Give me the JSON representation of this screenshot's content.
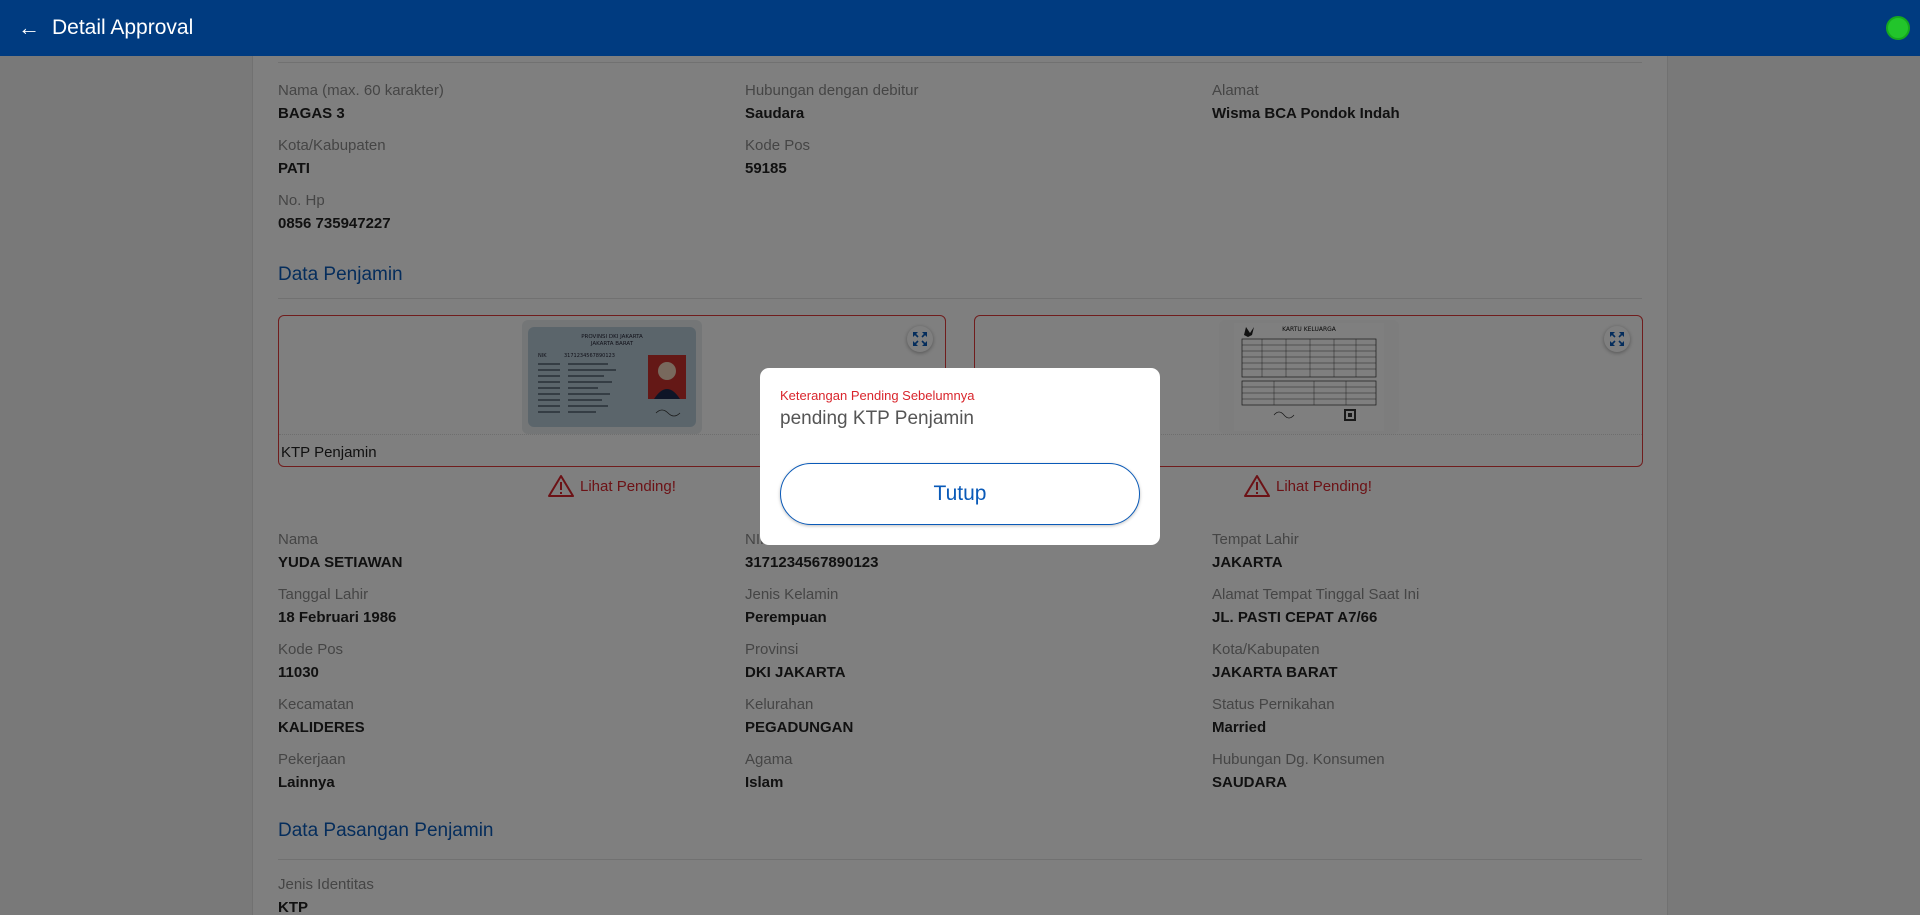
{
  "header": {
    "title": "Detail Approval",
    "back_icon": "arrow-left-icon",
    "status_color": "#22c52b"
  },
  "contact": {
    "nama": {
      "label": "Nama (max. 60 karakter)",
      "value": "BAGAS 3"
    },
    "hubungan": {
      "label": "Hubungan dengan debitur",
      "value": "Saudara"
    },
    "alamat": {
      "label": "Alamat",
      "value": "Wisma BCA Pondok Indah"
    },
    "kota": {
      "label": "Kota/Kabupaten",
      "value": "PATI"
    },
    "kodepos": {
      "label": "Kode Pos",
      "value": "59185"
    },
    "nohp": {
      "label": "No. Hp",
      "value": "0856 735947227"
    }
  },
  "penjamin": {
    "section_title": "Data Penjamin",
    "docs": [
      {
        "caption": "KTP Penjamin",
        "pending_label": "Lihat Pending!"
      },
      {
        "caption": "",
        "pending_label": "Lihat Pending!"
      }
    ],
    "ktp_card": {
      "province": "PROVINSI DKI JAKARTA",
      "city": "JAKARTA BARAT",
      "nik": "3171234567890123"
    },
    "kk_card": {
      "title": "KARTU KELUARGA"
    },
    "fields": {
      "nama": {
        "label": "Nama",
        "value": "YUDA SETIAWAN"
      },
      "nik": {
        "label": "NIK",
        "value": "3171234567890123"
      },
      "tempat_lahir": {
        "label": "Tempat Lahir",
        "value": "JAKARTA"
      },
      "tanggal_lahir": {
        "label": "Tanggal Lahir",
        "value": "18 Februari 1986"
      },
      "jenis_kelamin": {
        "label": "Jenis Kelamin",
        "value": "Perempuan"
      },
      "alamat_tinggal": {
        "label": "Alamat Tempat Tinggal Saat Ini",
        "value": "JL. PASTI CEPAT A7/66"
      },
      "kode_pos": {
        "label": "Kode Pos",
        "value": "11030"
      },
      "provinsi": {
        "label": "Provinsi",
        "value": "DKI JAKARTA"
      },
      "kota": {
        "label": "Kota/Kabupaten",
        "value": "JAKARTA BARAT"
      },
      "kecamatan": {
        "label": "Kecamatan",
        "value": "KALIDERES"
      },
      "kelurahan": {
        "label": "Kelurahan",
        "value": "PEGADUNGAN"
      },
      "status_pernikahan": {
        "label": "Status Pernikahan",
        "value": "Married"
      },
      "pekerjaan": {
        "label": "Pekerjaan",
        "value": "Lainnya"
      },
      "agama": {
        "label": "Agama",
        "value": "Islam"
      },
      "hubungan_konsumen": {
        "label": "Hubungan Dg. Konsumen",
        "value": "SAUDARA"
      }
    }
  },
  "pasangan": {
    "section_title": "Data Pasangan Penjamin",
    "jenis_identitas": {
      "label": "Jenis Identitas",
      "value": "KTP"
    }
  },
  "dialog": {
    "label": "Keterangan Pending Sebelumnya",
    "text": "pending KTP Penjamin",
    "button_label": "Tutup"
  },
  "colors": {
    "primary": "#003b80",
    "accent": "#0a5ab8",
    "danger": "#d9252c"
  }
}
